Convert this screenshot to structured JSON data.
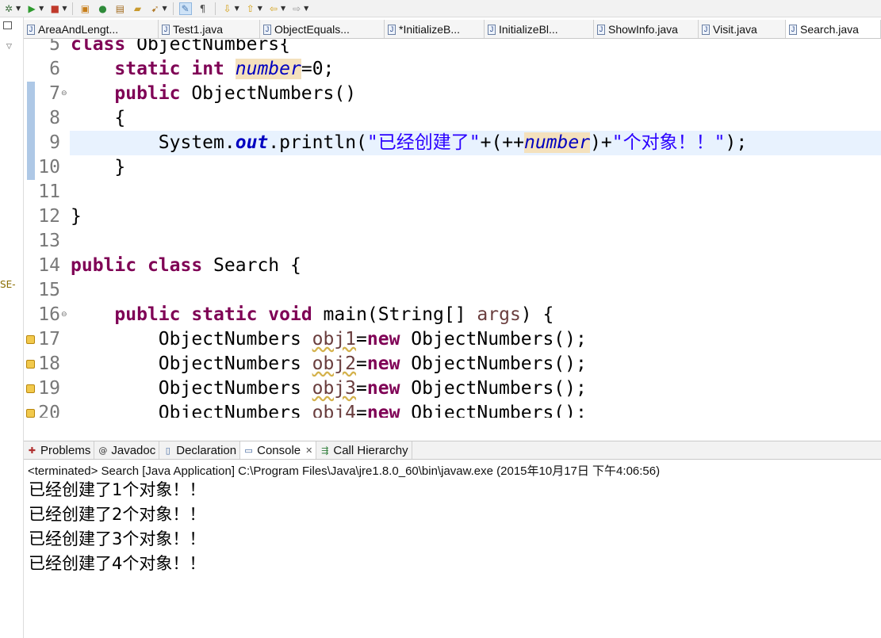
{
  "toolbar": {
    "buttons": [
      {
        "name": "debug-icon",
        "glyph": "✲",
        "color": "#3f6f3f"
      },
      {
        "name": "run-icon",
        "glyph": "▶",
        "color": "#2e9a2e"
      },
      {
        "name": "external-tools-icon",
        "glyph": "■",
        "color": "#c0392b"
      },
      {
        "name": "new-java-project-icon",
        "glyph": "▣",
        "color": "#c77d19"
      },
      {
        "name": "new-class-icon",
        "glyph": "●",
        "color": "#2f8b3a"
      },
      {
        "name": "open-type-icon",
        "glyph": "▤",
        "color": "#a36b1e"
      },
      {
        "name": "open-folder-icon",
        "glyph": "▰",
        "color": "#c99a2e"
      },
      {
        "name": "search-icon",
        "glyph": "➹",
        "color": "#b07a2a"
      },
      {
        "name": "toggle-mark-occurrences-icon",
        "glyph": "✎",
        "color": "#4a7bb5"
      },
      {
        "name": "show-whitespace-icon",
        "glyph": "¶",
        "color": "#555555"
      },
      {
        "name": "next-annotation-icon",
        "glyph": "⇩",
        "color": "#d4a017"
      },
      {
        "name": "prev-annotation-icon",
        "glyph": "⇧",
        "color": "#d4a017"
      },
      {
        "name": "back-icon",
        "glyph": "⇦",
        "color": "#d4a017"
      },
      {
        "name": "forward-icon",
        "glyph": "⇨",
        "color": "#999999"
      }
    ]
  },
  "left_strip": {
    "label": "SE-"
  },
  "editor_tabs": [
    {
      "label": "AreaAndLengt..."
    },
    {
      "label": "Test1.java"
    },
    {
      "label": "ObjectEquals..."
    },
    {
      "label": "*InitializeB..."
    },
    {
      "label": "InitializeBl..."
    },
    {
      "label": "ShowInfo.java"
    },
    {
      "label": "Visit.java"
    },
    {
      "label": "Search.java"
    }
  ],
  "editor": {
    "lines": [
      {
        "n": "5",
        "tokens": [
          [
            "kw",
            "class"
          ],
          [
            "plain",
            " ObjectNumbers{"
          ]
        ]
      },
      {
        "n": "6",
        "tokens": [
          [
            "plain",
            "    "
          ],
          [
            "kw",
            "static"
          ],
          [
            "plain",
            " "
          ],
          [
            "kw",
            "int"
          ],
          [
            "plain",
            " "
          ],
          [
            "fldocc",
            "number"
          ],
          [
            "plain",
            "=0;"
          ]
        ]
      },
      {
        "n": "7",
        "fold": "⊖",
        "tokens": [
          [
            "plain",
            "    "
          ],
          [
            "kw",
            "public"
          ],
          [
            "plain",
            " ObjectNumbers()"
          ]
        ]
      },
      {
        "n": "8",
        "tokens": [
          [
            "plain",
            "    {"
          ]
        ]
      },
      {
        "n": "9",
        "tokens": [
          [
            "plain",
            "        System."
          ],
          [
            "sfld",
            "out"
          ],
          [
            "plain",
            ".println("
          ],
          [
            "str",
            "\"已经创建了\""
          ],
          [
            "plain",
            "+(++"
          ],
          [
            "fldocc",
            "number"
          ],
          [
            "plain",
            ")+"
          ],
          [
            "str",
            "\"个对象！！\""
          ],
          [
            "plain",
            ");"
          ]
        ]
      },
      {
        "n": "10",
        "tokens": [
          [
            "plain",
            "    }"
          ]
        ]
      },
      {
        "n": "11",
        "tokens": []
      },
      {
        "n": "12",
        "tokens": [
          [
            "plain",
            "}"
          ]
        ]
      },
      {
        "n": "13",
        "tokens": []
      },
      {
        "n": "14",
        "tokens": [
          [
            "kw",
            "public"
          ],
          [
            "plain",
            " "
          ],
          [
            "kw",
            "class"
          ],
          [
            "plain",
            " Search {"
          ]
        ]
      },
      {
        "n": "15",
        "tokens": []
      },
      {
        "n": "16",
        "fold": "⊖",
        "tokens": [
          [
            "plain",
            "    "
          ],
          [
            "kw",
            "public"
          ],
          [
            "plain",
            " "
          ],
          [
            "kw",
            "static"
          ],
          [
            "plain",
            " "
          ],
          [
            "kw",
            "void"
          ],
          [
            "plain",
            " main(String[] "
          ],
          [
            "param",
            "args"
          ],
          [
            "plain",
            ") {"
          ]
        ]
      },
      {
        "n": "17",
        "warn": true,
        "tokens": [
          [
            "plain",
            "        ObjectNumbers "
          ],
          [
            "unused",
            "obj1"
          ],
          [
            "plain",
            "="
          ],
          [
            "kw",
            "new"
          ],
          [
            "plain",
            " ObjectNumbers();"
          ]
        ]
      },
      {
        "n": "18",
        "warn": true,
        "tokens": [
          [
            "plain",
            "        ObjectNumbers "
          ],
          [
            "unused",
            "obj2"
          ],
          [
            "plain",
            "="
          ],
          [
            "kw",
            "new"
          ],
          [
            "plain",
            " ObjectNumbers();"
          ]
        ]
      },
      {
        "n": "19",
        "warn": true,
        "tokens": [
          [
            "plain",
            "        ObjectNumbers "
          ],
          [
            "unused",
            "obj3"
          ],
          [
            "plain",
            "="
          ],
          [
            "kw",
            "new"
          ],
          [
            "plain",
            " ObjectNumbers();"
          ]
        ]
      },
      {
        "n": "20",
        "warn": true,
        "tokens": [
          [
            "plain",
            "        ObjectNumbers "
          ],
          [
            "unused",
            "obj4"
          ],
          [
            "plain",
            "="
          ],
          [
            "kw",
            "new"
          ],
          [
            "plain",
            " ObjectNumbers();"
          ]
        ]
      }
    ]
  },
  "view_tabs": [
    {
      "label": "Problems",
      "icon": "✚",
      "icon_name": "problems-icon",
      "color": "#b03030"
    },
    {
      "label": "Javadoc",
      "icon": "@",
      "icon_name": "javadoc-icon",
      "color": "#333333"
    },
    {
      "label": "Declaration",
      "icon": "▯",
      "icon_name": "declaration-icon",
      "color": "#4a6fa5"
    },
    {
      "label": "Console",
      "icon": "▭",
      "icon_name": "console-icon",
      "color": "#3a5f9a",
      "active": true,
      "close": "✕"
    },
    {
      "label": "Call Hierarchy",
      "icon": "⇶",
      "icon_name": "call-hierarchy-icon",
      "color": "#2f7d3a"
    }
  ],
  "console": {
    "status": "<terminated> Search [Java Application] C:\\Program Files\\Java\\jre1.8.0_60\\bin\\javaw.exe (2015年10月17日 下午4:06:56)",
    "output": [
      "已经创建了1个对象！！",
      "已经创建了2个对象！！",
      "已经创建了3个对象！！",
      "已经创建了4个对象！！"
    ]
  }
}
